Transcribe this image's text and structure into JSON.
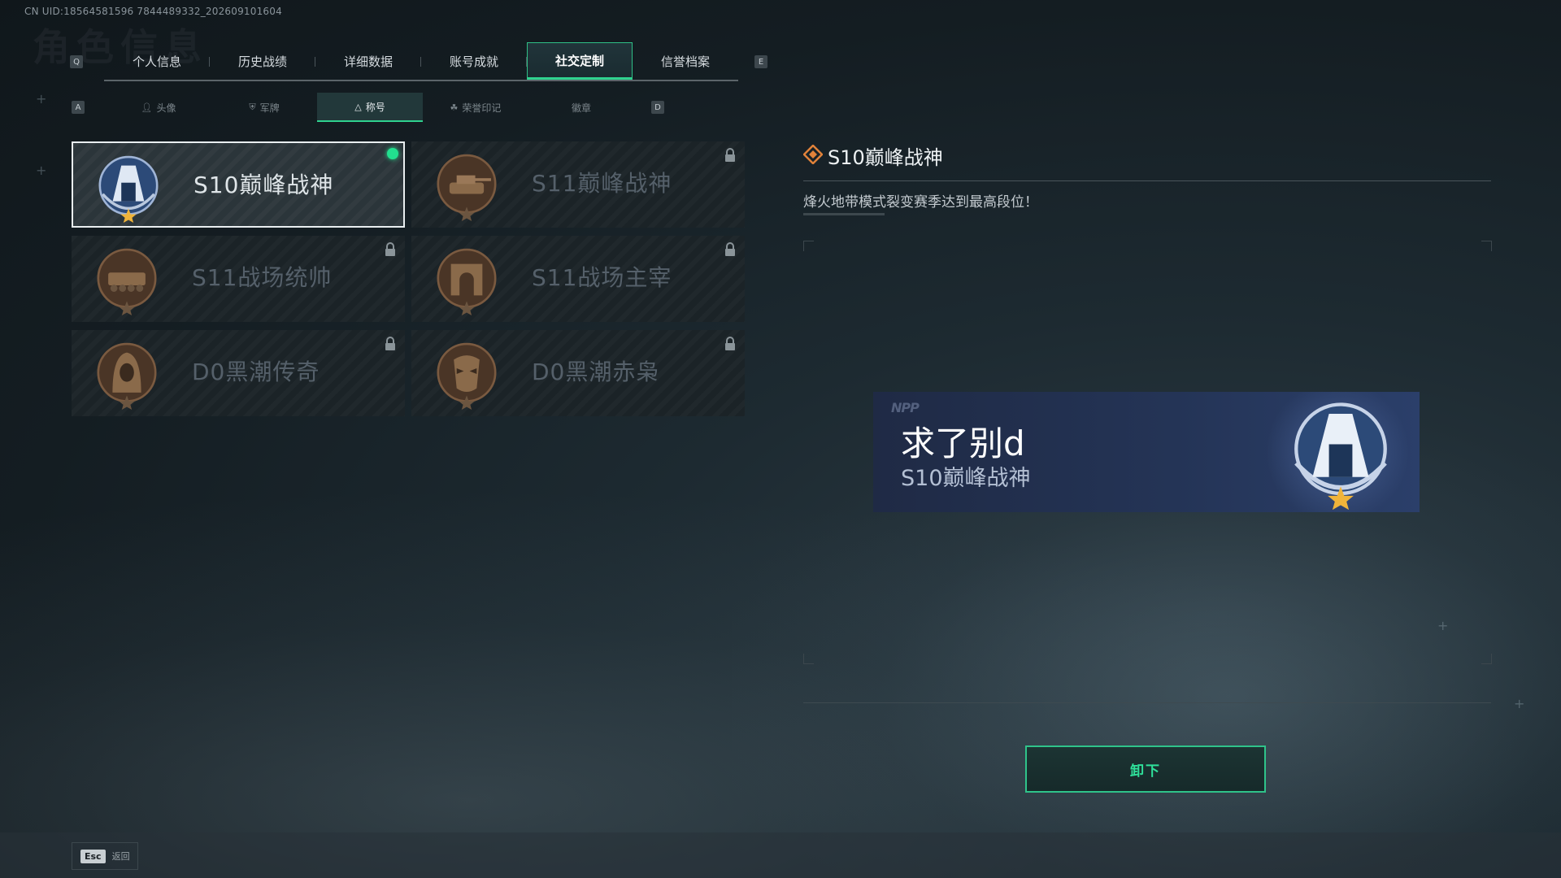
{
  "uid": "CN UID:18564581596 7844489332_202609101604",
  "watermark": "角色信息",
  "main_tabs": {
    "key_left": "Q",
    "key_right": "E",
    "items": [
      "个人信息",
      "历史战绩",
      "详细数据",
      "账号成就",
      "社交定制",
      "信誉档案"
    ],
    "active_index": 4
  },
  "sub_tabs": {
    "key_left": "A",
    "key_right": "D",
    "items": [
      {
        "label": "头像",
        "icon": "person-icon"
      },
      {
        "label": "军牌",
        "icon": "dogtag-icon"
      },
      {
        "label": "称号",
        "icon": "triangle-icon"
      },
      {
        "label": "荣誉印记",
        "icon": "laurel-icon"
      },
      {
        "label": "徽章",
        "icon": ""
      }
    ],
    "active_index": 2
  },
  "titles": [
    {
      "name": "S10巅峰战神",
      "emblem": "s10-peak-emblem",
      "locked": false,
      "equipped": true,
      "selected": true
    },
    {
      "name": "S11巅峰战神",
      "emblem": "s11-tank-emblem",
      "locked": true,
      "equipped": false,
      "selected": false
    },
    {
      "name": "S11战场统帅",
      "emblem": "s11-apc-emblem",
      "locked": true,
      "equipped": false,
      "selected": false
    },
    {
      "name": "S11战场主宰",
      "emblem": "s11-arch-emblem",
      "locked": true,
      "equipped": false,
      "selected": false
    },
    {
      "name": "D0黑潮传奇",
      "emblem": "d0-hooded-emblem",
      "locked": true,
      "equipped": false,
      "selected": false
    },
    {
      "name": "D0黑潮赤枭",
      "emblem": "d0-mask-emblem",
      "locked": true,
      "equipped": false,
      "selected": false
    }
  ],
  "detail": {
    "title": "S10巅峰战神",
    "description": "烽火地带模式裂变赛季达到最高段位！"
  },
  "nameplate": {
    "player_name": "求了别d",
    "title": "S10巅峰战神"
  },
  "actions": {
    "unequip": "卸下",
    "back_key": "Esc",
    "back_label": "返回"
  },
  "colors": {
    "accent": "#2fd28f",
    "equipped_dot": "#22e08f",
    "plate_bg": "#243456",
    "gold_star": "#f0b43a"
  }
}
